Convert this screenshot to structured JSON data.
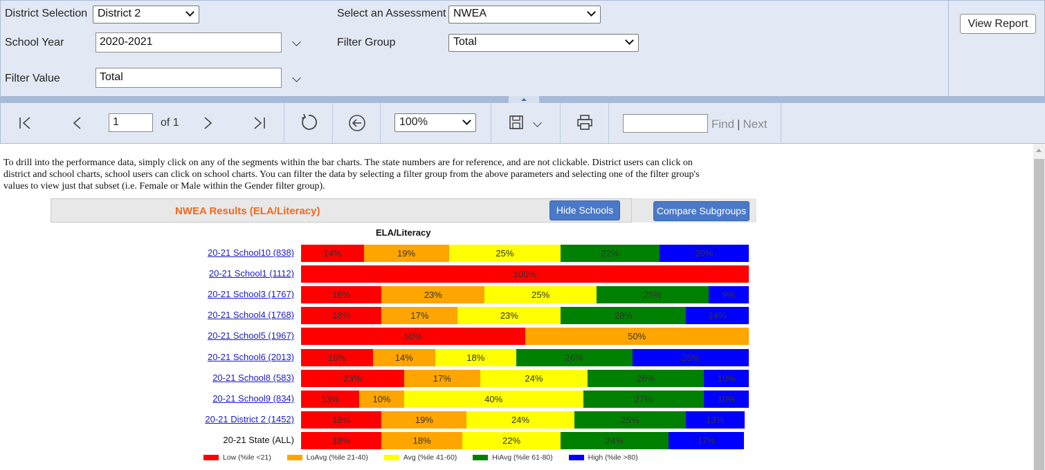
{
  "params": {
    "district_label": "District Selection",
    "district_value": "District 2",
    "assessment_label": "Select an Assessment",
    "assessment_value": "NWEA",
    "school_year_label": "School Year",
    "school_year_value": "2020-2021",
    "filter_group_label": "Filter Group",
    "filter_group_value": "Total",
    "filter_value_label": "Filter Value",
    "filter_value_value": "Total",
    "view_report_label": "View Report"
  },
  "toolbar": {
    "page_value": "1",
    "page_of": "of 1",
    "zoom_value": "100%",
    "find_value": "",
    "find_label": "Find",
    "find_sep": "|",
    "next_label": "Next",
    "icons": [
      "first-page-icon",
      "previous-page-icon",
      "next-page-icon",
      "last-page-icon",
      "refresh-icon",
      "back-icon",
      "save-icon",
      "print-icon"
    ]
  },
  "report": {
    "intro": "To drill into the performance data, simply click on any of the segments within the bar charts.  The state numbers are for reference, and are not clickable.  District users can click on district and school charts, school users can click on school charts.  You can filter the data by selecting a filter group from the above parameters and selecting one of the filter group's values to view just that subset (i.e. Female or Male within the Gender filter group).",
    "header_title": "NWEA Results (ELA/Literacy)",
    "hide_schools_label": "Hide Schools",
    "compare_subgroups_label": "Compare Subgroups"
  },
  "chart_data": {
    "type": "bar",
    "orientation": "horizontal-stacked-100",
    "title": "ELA/Literacy",
    "categories": [
      "20-21 School10 (838)",
      "20-21 School1 (1112)",
      "20-21 School3 (1767)",
      "20-21 School4 (1768)",
      "20-21 School5 (1967)",
      "20-21 School6 (2013)",
      "20-21 School8 (583)",
      "20-21 School9 (834)",
      "20-21 District 2 (1452)",
      "20-21 State (ALL)"
    ],
    "clickable": [
      true,
      true,
      true,
      true,
      true,
      true,
      true,
      true,
      true,
      false
    ],
    "series": [
      {
        "name": "Low (%ile <21)",
        "color": "#ff0000",
        "values": [
          14,
          100,
          18,
          18,
          50,
          16,
          23,
          13,
          18,
          18
        ]
      },
      {
        "name": "LoAvg (%ile 21-40)",
        "color": "#ffa500",
        "values": [
          19,
          0,
          23,
          17,
          50,
          14,
          17,
          10,
          19,
          18
        ]
      },
      {
        "name": "Avg (%ile 41-60)",
        "color": "#ffff00",
        "values": [
          25,
          0,
          25,
          23,
          0,
          18,
          24,
          40,
          24,
          22
        ]
      },
      {
        "name": "HiAvg (%ile 61-80)",
        "color": "#008000",
        "values": [
          22,
          0,
          25,
          28,
          0,
          26,
          26,
          27,
          25,
          24
        ]
      },
      {
        "name": "High (%ile >80)",
        "color": "#0000ff",
        "values": [
          20,
          0,
          9,
          14,
          0,
          26,
          10,
          10,
          13,
          17
        ]
      }
    ],
    "legend_position": "bottom"
  }
}
